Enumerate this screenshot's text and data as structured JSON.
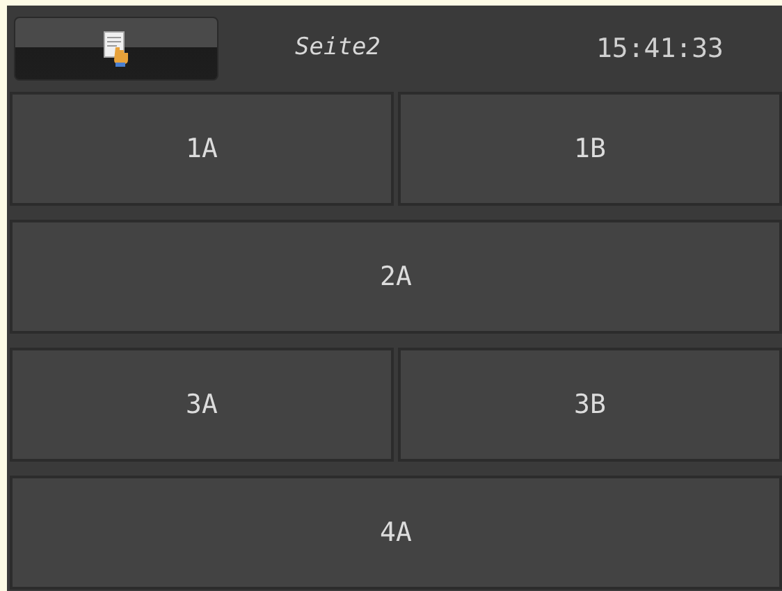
{
  "header": {
    "page_title": "Seite2",
    "clock": "15:41:33"
  },
  "rows": [
    {
      "buttons": [
        "1A",
        "1B"
      ]
    },
    {
      "buttons": [
        "2A"
      ]
    },
    {
      "buttons": [
        "3A",
        "3B"
      ]
    },
    {
      "buttons": [
        "4A"
      ]
    }
  ]
}
